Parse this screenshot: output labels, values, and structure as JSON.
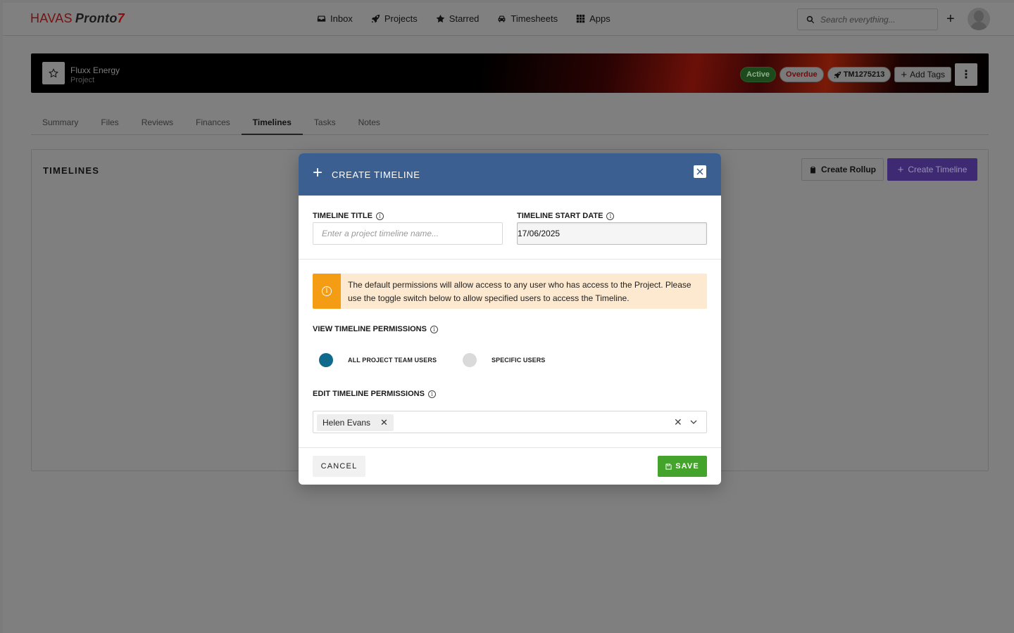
{
  "brand": {
    "logo_text": "HAVAS",
    "logo_product": "Pronto",
    "logo_mark": "7"
  },
  "nav": {
    "items": [
      {
        "label": "Inbox",
        "icon": "inbox-icon"
      },
      {
        "label": "Projects",
        "icon": "rocket-icon"
      },
      {
        "label": "Starred",
        "icon": "star-icon"
      },
      {
        "label": "Timesheets",
        "icon": "car-icon"
      },
      {
        "label": "Apps",
        "icon": "grid-icon"
      }
    ],
    "search_placeholder": "Search everything...",
    "add_label": "+"
  },
  "project": {
    "name": "Fluxx Energy",
    "type": "Project",
    "status_active": "Active",
    "status_overdue": "Overdue",
    "code": "TM1275213",
    "add_tags_label": "Add Tags",
    "more_label": "⋮"
  },
  "tabs": [
    {
      "label": "Summary",
      "selected": false
    },
    {
      "label": "Files",
      "selected": false
    },
    {
      "label": "Reviews",
      "selected": false
    },
    {
      "label": "Finances",
      "selected": false
    },
    {
      "label": "Timelines",
      "selected": true
    },
    {
      "label": "Tasks",
      "selected": false
    },
    {
      "label": "Notes",
      "selected": false
    }
  ],
  "panel": {
    "title": "TIMELINES",
    "rollup_label": "Create Rollup",
    "create_label": "Create Timeline"
  },
  "modal": {
    "title": "CREATE TIMELINE",
    "title_label": "TIMELINE TITLE",
    "title_placeholder": "Enter a project timeline name...",
    "title_value": "",
    "start_label": "TIMELINE START DATE",
    "start_value": "17/06/2025",
    "notice": "The default permissions will allow access to any user who has access to the Project. Please use the toggle switch below to allow specified users to access the Timeline.",
    "view_label": "VIEW TIMELINE PERMISSIONS",
    "view_options": [
      {
        "label": "ALL PROJECT TEAM USERS",
        "selected": true
      },
      {
        "label": "SPECIFIC USERS",
        "selected": false
      }
    ],
    "edit_label": "EDIT TIMELINE PERMISSIONS",
    "edit_users": [
      "Helen Evans"
    ],
    "cancel_label": "CANCEL",
    "save_label": "SAVE",
    "colors": {
      "header": "#3b5f91",
      "save": "#43a32a",
      "notice_bg": "#fde9cf",
      "notice_icon": "#f59c15",
      "radio_on": "#0f6a8c"
    }
  }
}
